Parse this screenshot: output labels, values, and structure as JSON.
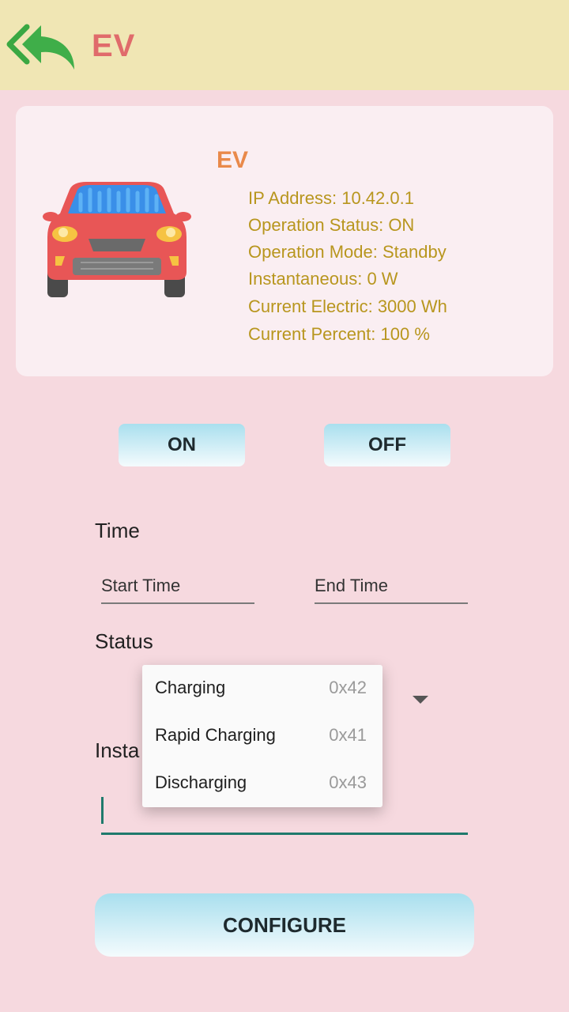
{
  "header": {
    "title": "EV",
    "back_icon": "back-arrow-icon"
  },
  "device": {
    "name": "EV",
    "icon": "car-icon",
    "info": [
      "IP Address: 10.42.0.1",
      "Operation Status: ON",
      "Operation Mode: Standby",
      "Instantaneous: 0 W",
      "Current Electric: 3000 Wh",
      "Current Percent: 100 %"
    ]
  },
  "controls": {
    "on_label": "ON",
    "off_label": "OFF"
  },
  "form": {
    "time_label": "Time",
    "start_placeholder": "Start Time",
    "end_placeholder": "End Time",
    "status_label": "Status",
    "instantaneous_label": "Insta"
  },
  "status_menu": {
    "items": [
      {
        "label": "Charging",
        "code": "0x42"
      },
      {
        "label": "Rapid Charging",
        "code": "0x41"
      },
      {
        "label": "Discharging",
        "code": "0x43"
      }
    ]
  },
  "configure_label": "CONFIGURE",
  "colors": {
    "background": "#f6d9df",
    "appbar": "#f0e6b4",
    "title": "#e06b6b",
    "device_name": "#e9894a",
    "info_text": "#b8961e",
    "accent": "#1f7a6c"
  }
}
